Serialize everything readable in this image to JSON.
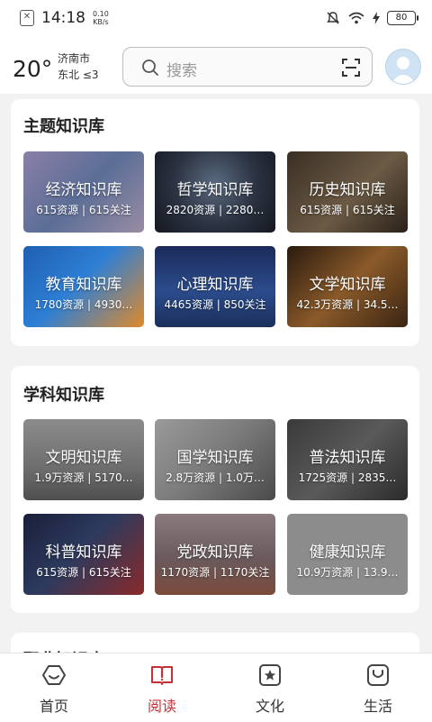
{
  "status_bar": {
    "time": "14:18",
    "speed_value": "0.10",
    "speed_unit": "KB/s",
    "battery": "80"
  },
  "header": {
    "temperature": "20°",
    "city": "济南市",
    "wind": "东北  ≤3",
    "search_placeholder": "搜索"
  },
  "sections": [
    {
      "title": "主题知识库",
      "tiles": [
        {
          "name": "经济知识库",
          "stats": "615资源 | 615关注"
        },
        {
          "name": "哲学知识库",
          "stats": "2820资源 | 2280…"
        },
        {
          "name": "历史知识库",
          "stats": "615资源 | 615关注"
        },
        {
          "name": "教育知识库",
          "stats": "1780资源 | 4930…"
        },
        {
          "name": "心理知识库",
          "stats": "4465资源 | 850关注"
        },
        {
          "name": "文学知识库",
          "stats": "42.3万资源 | 34.5…"
        }
      ]
    },
    {
      "title": "学科知识库",
      "tiles": [
        {
          "name": "文明知识库",
          "stats": "1.9万资源 | 5170…"
        },
        {
          "name": "国学知识库",
          "stats": "2.8万资源 | 1.0万…"
        },
        {
          "name": "普法知识库",
          "stats": "1725资源 | 2835…"
        },
        {
          "name": "科普知识库",
          "stats": "615资源 | 615关注"
        },
        {
          "name": "党政知识库",
          "stats": "1170资源 | 1170关注"
        },
        {
          "name": "健康知识库",
          "stats": "10.9万资源 | 13.9…"
        }
      ]
    },
    {
      "title": "职业知识库"
    }
  ],
  "bottom_nav": [
    {
      "label": "首页",
      "icon": "home-icon"
    },
    {
      "label": "阅读",
      "icon": "book-icon",
      "active": true
    },
    {
      "label": "文化",
      "icon": "star-icon"
    },
    {
      "label": "生活",
      "icon": "smile-bag-icon"
    }
  ],
  "colors": {
    "accent": "#c62f36",
    "background": "#f2f2f2"
  }
}
